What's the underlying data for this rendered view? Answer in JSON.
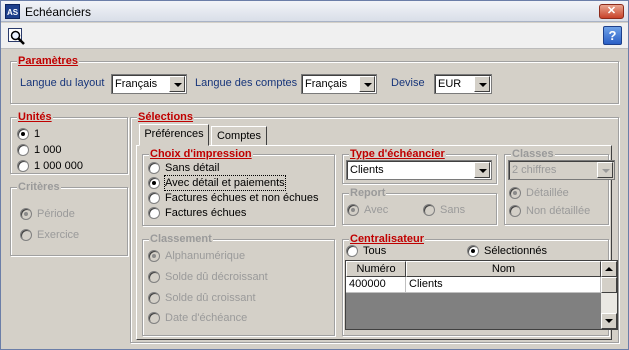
{
  "window": {
    "title": "Echéanciers",
    "app_icon": "AS",
    "close_symbol": "✕"
  },
  "toolbar": {
    "search_icon": "magnifier-icon",
    "help_label": "?"
  },
  "parametres": {
    "legend": "Paramètres",
    "langue_layout_label": "Langue du layout",
    "langue_layout_value": "Français",
    "langue_comptes_label": "Langue des comptes",
    "langue_comptes_value": "Français",
    "devise_label": "Devise",
    "devise_value": "EUR"
  },
  "unites": {
    "legend": "Unités",
    "options": [
      "1",
      "1 000",
      "1 000 000"
    ],
    "selected": "1"
  },
  "criteres": {
    "legend": "Critères",
    "options": [
      "Période",
      "Exercice"
    ],
    "selected": "Période"
  },
  "selections": {
    "legend": "Sélections",
    "tabs": [
      "Préférences",
      "Comptes"
    ],
    "active_tab": "Préférences",
    "choix_impression": {
      "legend": "Choix d'impression",
      "options": [
        "Sans détail",
        "Avec détail et paiements",
        "Factures échues et non échues",
        "Factures échues"
      ],
      "selected": "Avec détail et paiements"
    },
    "type_echeancier": {
      "legend": "Type d'échéancier",
      "value": "Clients"
    },
    "classes": {
      "legend": "Classes",
      "value": "2 chiffres",
      "options": [
        "Détaillée",
        "Non détaillée"
      ],
      "selected": "Détaillée"
    },
    "report": {
      "legend": "Report",
      "options": [
        "Avec",
        "Sans"
      ],
      "selected": "Avec"
    },
    "classement": {
      "legend": "Classement",
      "options": [
        "Alphanumérique",
        "Solde dû décroissant",
        "Solde dû croissant",
        "Date d'échéance"
      ],
      "selected": "Alphanumérique"
    },
    "centralisateur": {
      "legend": "Centralisateur",
      "options": [
        "Tous",
        "Sélectionnés"
      ],
      "selected": "Sélectionnés",
      "columns": [
        "Numéro",
        "Nom"
      ],
      "rows": [
        [
          "400000",
          "Clients"
        ]
      ]
    }
  },
  "colors": {
    "legend_red": "#c00000",
    "label_blue": "#17357a",
    "face": "#d4d0c8"
  }
}
